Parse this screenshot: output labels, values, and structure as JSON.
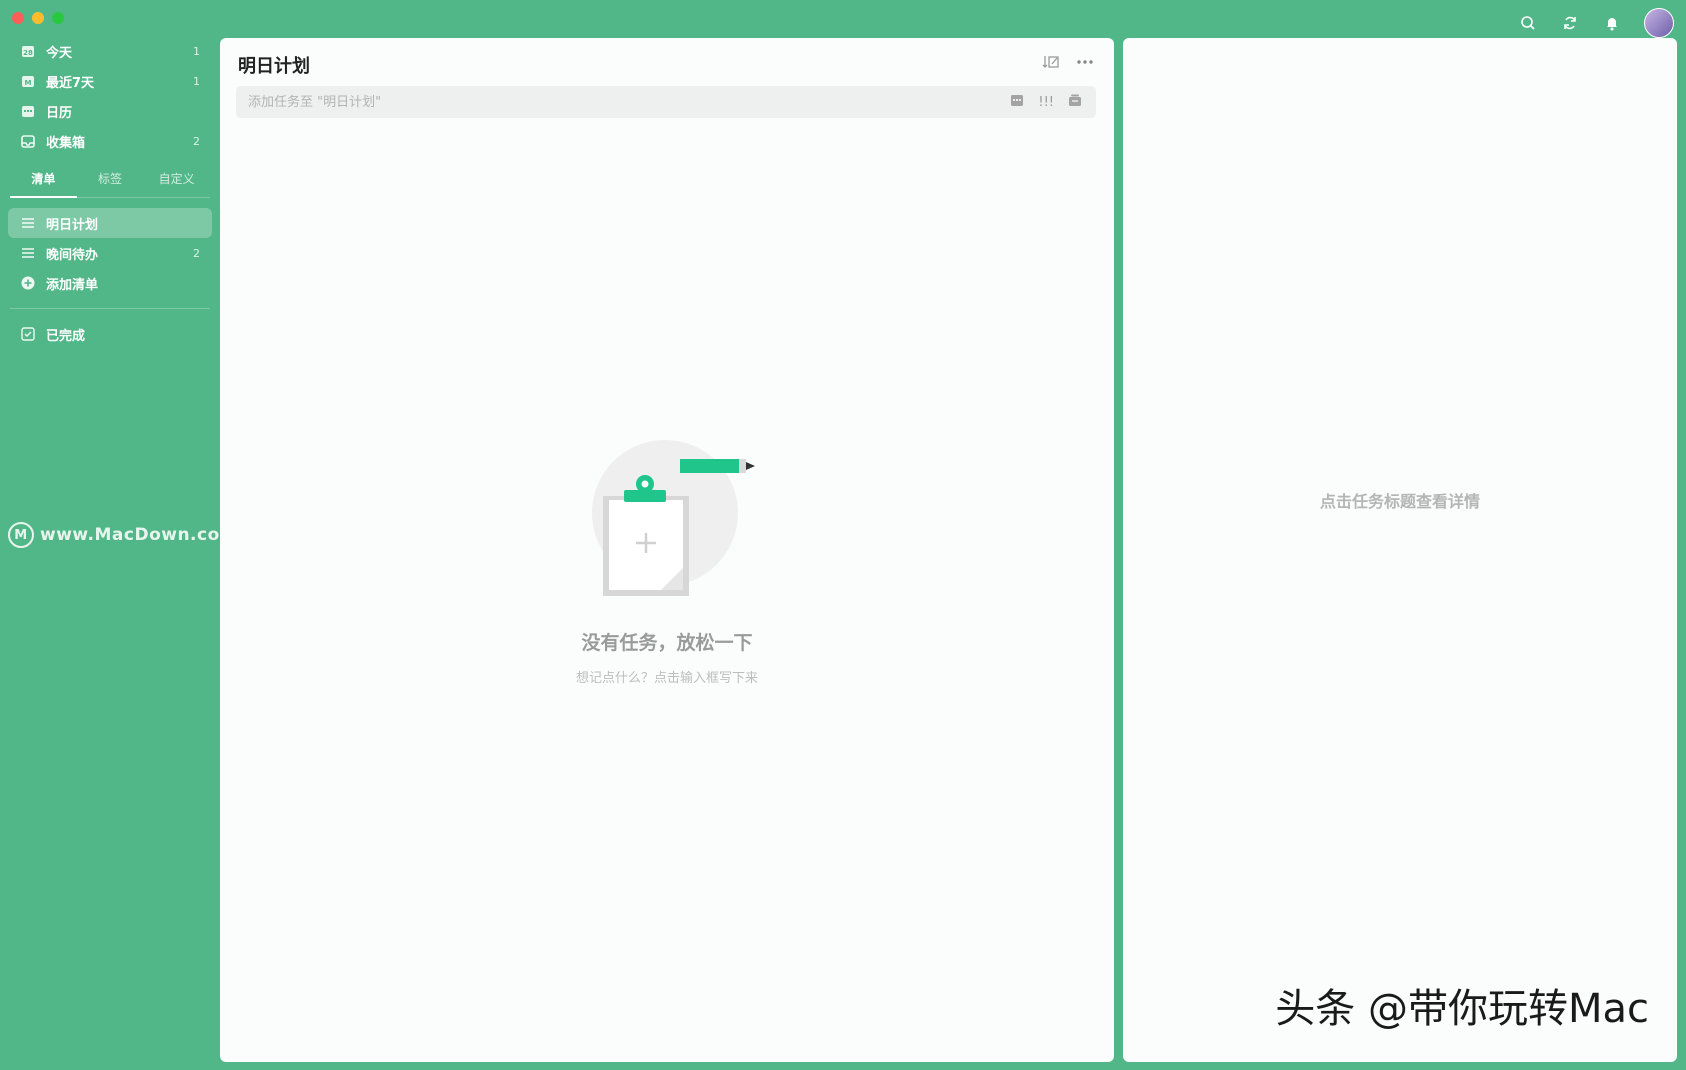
{
  "colors": {
    "accent": "#52b788",
    "brand_green": "#1fc58b"
  },
  "titlebar": {
    "icons": [
      "search-icon",
      "sync-icon",
      "bell-icon",
      "avatar"
    ]
  },
  "sidebar": {
    "smart_lists": [
      {
        "label": "今天",
        "count": "1",
        "icon": "calendar-today-icon"
      },
      {
        "label": "最近7天",
        "count": "1",
        "icon": "calendar-week-icon"
      },
      {
        "label": "日历",
        "count": "",
        "icon": "calendar-icon"
      },
      {
        "label": "收集箱",
        "count": "2",
        "icon": "inbox-icon"
      }
    ],
    "tabs": [
      "清单",
      "标签",
      "自定义"
    ],
    "lists": [
      {
        "label": "明日计划",
        "count": ""
      },
      {
        "label": "晚间待办",
        "count": "2"
      }
    ],
    "add_list_label": "添加清单",
    "completed_label": "已完成"
  },
  "watermark": {
    "text": "www.MacDown.com"
  },
  "main": {
    "title": "明日计划",
    "add_placeholder": "添加任务至 \"明日计划\"",
    "priority_label": "!!!",
    "empty_title": "没有任务，放松一下",
    "empty_subtitle": "想记点什么？点击输入框写下来"
  },
  "detail": {
    "hint": "点击任务标题查看详情"
  },
  "overlay": {
    "toutiao": "头条 @带你玩转Mac"
  }
}
